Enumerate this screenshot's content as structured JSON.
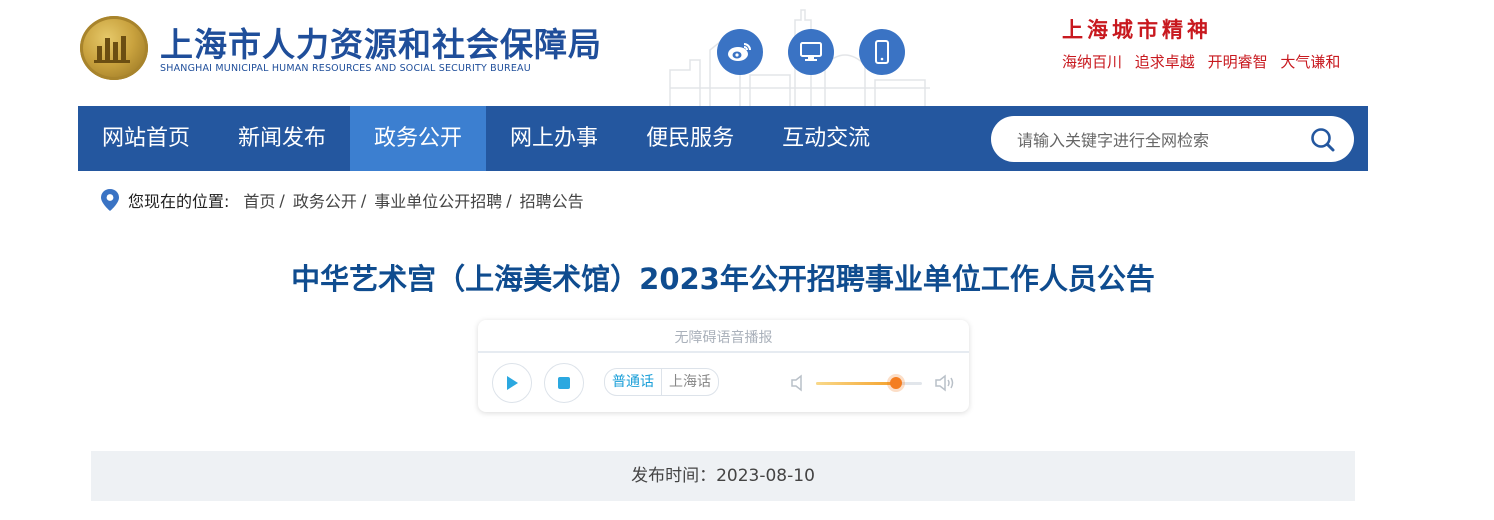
{
  "header": {
    "org_name_cn": "上海市人力资源和社会保障局",
    "org_name_en": "SHANGHAI MUNICIPAL HUMAN RESOURCES AND SOCIAL SECURITY BUREAU",
    "quick_icons": [
      "weibo-icon",
      "desktop-icon",
      "mobile-icon"
    ],
    "slogan_title": "上海城市精神",
    "slogan_items": [
      "海纳百川",
      "追求卓越",
      "开明睿智",
      "大气谦和"
    ]
  },
  "nav": {
    "items": [
      "网站首页",
      "新闻发布",
      "政务公开",
      "网上办事",
      "便民服务",
      "互动交流"
    ],
    "active_index": 2,
    "search_placeholder": "请输入关键字进行全网检索"
  },
  "breadcrumb": {
    "label": "您现在的位置:",
    "items": [
      "首页",
      "政务公开",
      "事业单位公开招聘",
      "招聘公告"
    ],
    "separator": "/"
  },
  "article": {
    "title": "中华艺术宫（上海美术馆）2023年公开招聘事业单位工作人员公告",
    "publish_label": "发布时间：",
    "publish_date": "2023-08-10",
    "publish_text": "发布时间：2023-08-10"
  },
  "player": {
    "title": "无障碍语音播报",
    "languages": [
      "普通话",
      "上海话"
    ],
    "selected_language": "普通话",
    "volume": 0.75
  },
  "colors": {
    "nav_bg": "#24579f",
    "nav_active": "#3c7fd0",
    "title_blue": "#0f4c8f",
    "slogan_red": "#c8191f"
  }
}
